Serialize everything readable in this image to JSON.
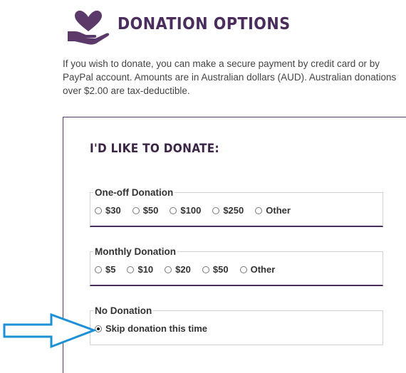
{
  "header": {
    "title": "DONATION OPTIONS",
    "logo_icon": "heart-in-hand-icon",
    "accent_color": "#5b3a6a"
  },
  "intro": {
    "text": "If you wish to donate, you can make a secure payment by credit card or by PayPal account. Amounts are in Australian dollars (AUD). Australian donations over $2.00 are tax-deductible."
  },
  "form": {
    "title": "I'D LIKE TO DONATE:",
    "groups": [
      {
        "legend": "One-off Donation",
        "options": [
          "$30",
          "$50",
          "$100",
          "$250",
          "Other"
        ],
        "selected": null
      },
      {
        "legend": "Monthly Donation",
        "options": [
          "$5",
          "$10",
          "$20",
          "$50",
          "Other"
        ],
        "selected": null
      },
      {
        "legend": "No Donation",
        "options": [
          "Skip donation this time"
        ],
        "selected": 0
      }
    ]
  },
  "annotation": {
    "arrow_icon": "arrow-right-outline-icon",
    "arrow_color": "#1e90d6"
  }
}
